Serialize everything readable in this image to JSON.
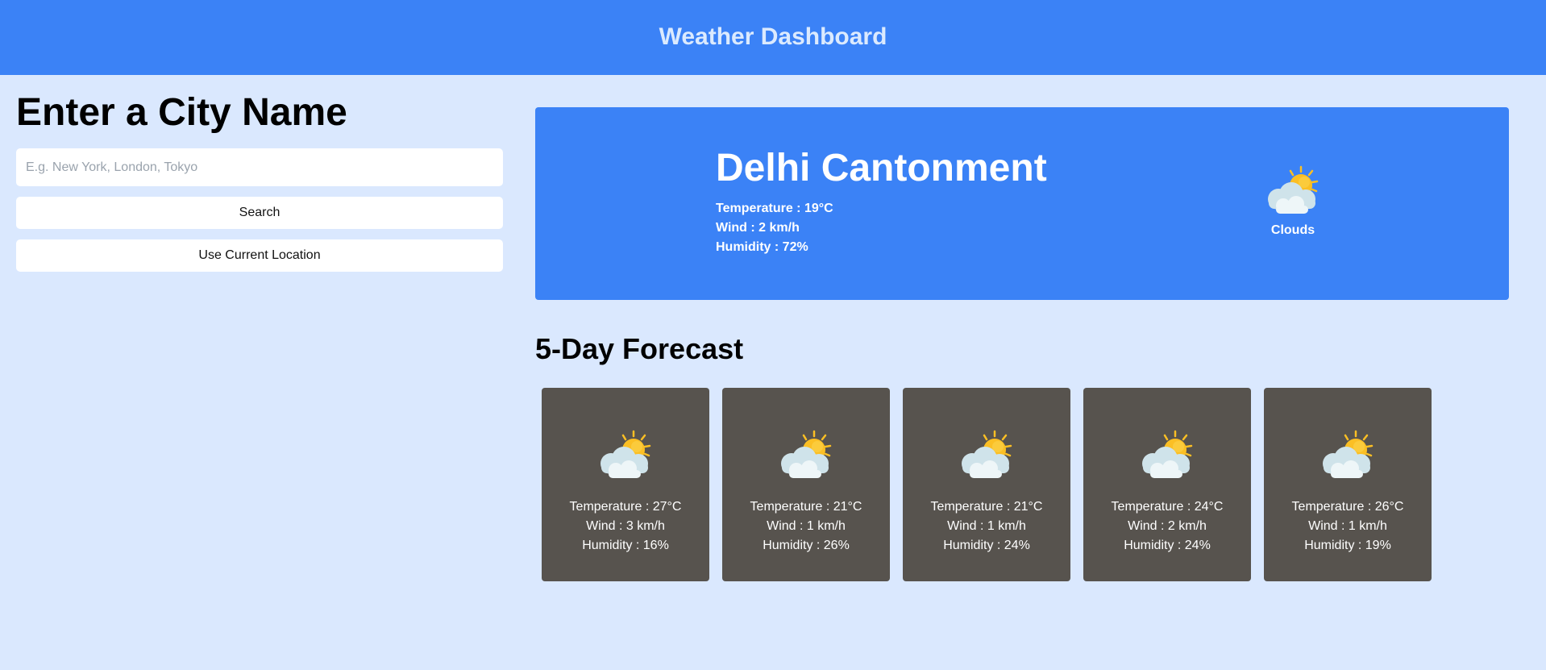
{
  "header": {
    "title": "Weather Dashboard"
  },
  "search": {
    "heading": "Enter a City Name",
    "placeholder": "E.g. New York, London, Tokyo",
    "value": "",
    "search_label": "Search",
    "location_label": "Use Current Location"
  },
  "current": {
    "city": "Delhi Cantonment",
    "temperature": "Temperature : 19°C",
    "wind": "Wind : 2 km/h",
    "humidity": "Humidity : 72%",
    "description": "Clouds",
    "icon": "partly-cloudy-icon"
  },
  "forecast": {
    "title": "5-Day Forecast",
    "days": [
      {
        "icon": "partly-cloudy-icon",
        "temperature": "Temperature : 27°C",
        "wind": "Wind : 3 km/h",
        "humidity": "Humidity : 16%"
      },
      {
        "icon": "partly-cloudy-icon",
        "temperature": "Temperature : 21°C",
        "wind": "Wind : 1 km/h",
        "humidity": "Humidity : 26%"
      },
      {
        "icon": "partly-cloudy-icon",
        "temperature": "Temperature : 21°C",
        "wind": "Wind : 1 km/h",
        "humidity": "Humidity : 24%"
      },
      {
        "icon": "partly-cloudy-icon",
        "temperature": "Temperature : 24°C",
        "wind": "Wind : 2 km/h",
        "humidity": "Humidity : 24%"
      },
      {
        "icon": "partly-cloudy-icon",
        "temperature": "Temperature : 26°C",
        "wind": "Wind : 1 km/h",
        "humidity": "Humidity : 19%"
      }
    ]
  },
  "colors": {
    "page_background": "#dae8fe",
    "header_background": "#3b82f6",
    "header_text": "#dbeafe",
    "current_card": "#3b82f6",
    "forecast_card": "#57534e",
    "sun": "#fbbf24",
    "cloud": "#cfe3ea"
  }
}
